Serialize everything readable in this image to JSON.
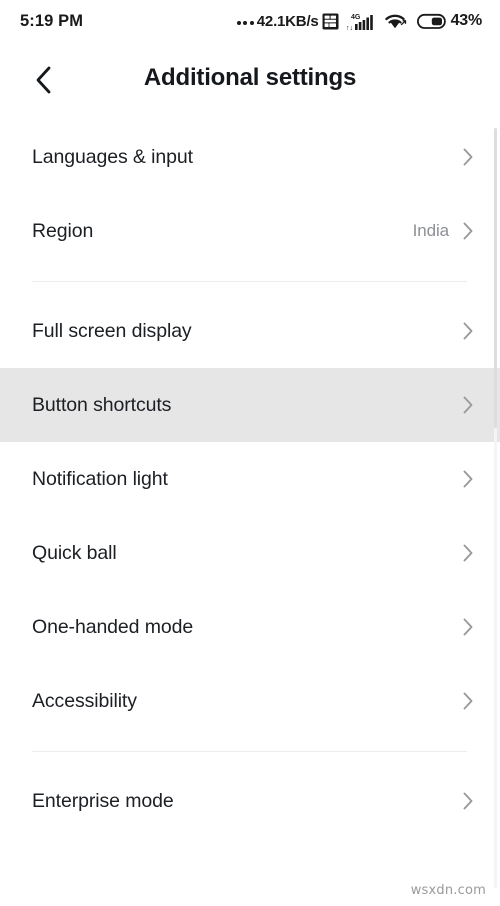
{
  "status_bar": {
    "time": "5:19 PM",
    "network_speed": "42.1KB/s",
    "network_type": "4G",
    "battery_percent": "43%",
    "icons": {
      "overflow_dots": "overflow-dots-icon",
      "sim_card": "sim-card-icon",
      "signal": "cellular-signal-icon",
      "wifi": "wifi-icon",
      "battery": "battery-icon"
    }
  },
  "header": {
    "title": "Additional settings",
    "back_icon": "chevron-left-icon"
  },
  "colors": {
    "background": "#ffffff",
    "selected_row": "#e6e6e6",
    "divider": "#ececec",
    "primary_text": "#1c1f23",
    "secondary_text": "#8c8f93",
    "chevron": "#9a9a9a",
    "scrollbar_thumb": "#dddddd"
  },
  "groups": [
    {
      "items": [
        {
          "label": "Languages & input",
          "value": "",
          "selected": false
        },
        {
          "label": "Region",
          "value": "India",
          "selected": false
        }
      ]
    },
    {
      "items": [
        {
          "label": "Full screen display",
          "value": "",
          "selected": false
        },
        {
          "label": "Button shortcuts",
          "value": "",
          "selected": true
        },
        {
          "label": "Notification light",
          "value": "",
          "selected": false
        },
        {
          "label": "Quick ball",
          "value": "",
          "selected": false
        },
        {
          "label": "One-handed mode",
          "value": "",
          "selected": false
        },
        {
          "label": "Accessibility",
          "value": "",
          "selected": false
        }
      ]
    },
    {
      "items": [
        {
          "label": "Enterprise mode",
          "value": "",
          "selected": false
        }
      ]
    }
  ],
  "watermark": "wsxdn.com"
}
